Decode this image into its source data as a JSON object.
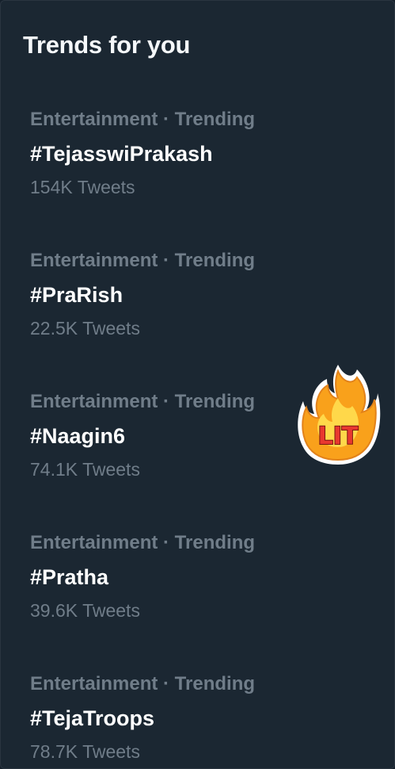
{
  "panel": {
    "title": "Trends for you"
  },
  "trends": [
    {
      "meta": "Entertainment · Trending",
      "name": "#TejasswiPrakash",
      "count": "154K Tweets"
    },
    {
      "meta": "Entertainment · Trending",
      "name": "#PraRish",
      "count": "22.5K Tweets"
    },
    {
      "meta": "Entertainment · Trending",
      "name": "#Naagin6",
      "count": "74.1K Tweets"
    },
    {
      "meta": "Entertainment · Trending",
      "name": "#Pratha",
      "count": "39.6K Tweets"
    },
    {
      "meta": "Entertainment · Trending",
      "name": "#TejaTroops",
      "count": "78.7K Tweets"
    }
  ],
  "sticker": {
    "text": "LIT",
    "icon": "fire-lit-sticker-icon"
  },
  "colors": {
    "background": "#1b2732",
    "primary_text": "#ffffff",
    "secondary_text": "#707d89",
    "flame_outer": "#f9a11b",
    "flame_inner": "#ffd84a",
    "lit_text": "#e8382f"
  }
}
